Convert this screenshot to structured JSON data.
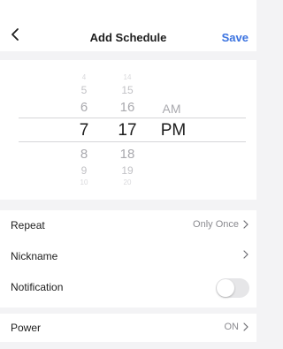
{
  "header": {
    "title": "Add Schedule",
    "save_label": "Save",
    "back_icon": "chevron-left-icon"
  },
  "picker": {
    "hours": [
      "4",
      "5",
      "6",
      "7",
      "8",
      "9",
      "10"
    ],
    "minutes": [
      "14",
      "15",
      "16",
      "17",
      "18",
      "19",
      "20"
    ],
    "periods": [
      "AM",
      "PM"
    ],
    "selected": {
      "hour": "7",
      "minute": "17",
      "period": "PM"
    }
  },
  "settings": {
    "repeat": {
      "label": "Repeat",
      "value": "Only Once"
    },
    "nickname": {
      "label": "Nickname",
      "value": ""
    },
    "notification": {
      "label": "Notification",
      "enabled": false
    }
  },
  "power": {
    "label": "Power",
    "value": "ON"
  },
  "colors": {
    "accent": "#3b73e0",
    "background": "#f3f3f5",
    "toggle_off": "#e6e6e8"
  }
}
